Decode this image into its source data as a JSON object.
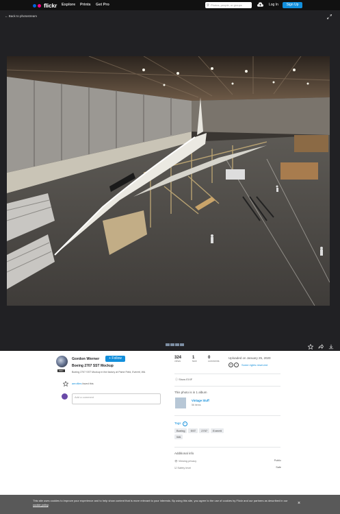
{
  "header": {
    "logo": "flickr",
    "nav": [
      "Explore",
      "Prints",
      "Get Pro"
    ],
    "search_placeholder": "Photos, people, or groups",
    "login": "Log In",
    "signup": "Sign Up",
    "colors": {
      "bar": "#111111",
      "signup": "#128fdc",
      "dot_blue": "#0063dc",
      "dot_pink": "#ff0084"
    }
  },
  "viewer": {
    "back_label": "Back to photostream",
    "icons": [
      "expand-icon",
      "star-icon",
      "share-icon",
      "download-icon"
    ]
  },
  "photo": {
    "owner": "Gordon Werner",
    "pro_badge": "PRO",
    "follow_label": "+ Follow",
    "title": "Boeing 2707 SST Mockup",
    "description": "Boeing 2707 SST Mockup in the factory at Paine Field, Everett, WA",
    "faves_user": "aerofiles",
    "faves_suffix": "faved this",
    "comment_placeholder": "Add a comment"
  },
  "stats": [
    {
      "value": "324",
      "label": "views"
    },
    {
      "value": "1",
      "label": "fave"
    },
    {
      "value": "0",
      "label": "comments"
    }
  ],
  "meta": {
    "uploaded": "Uploaded on January 25, 2020",
    "license": "Some rights reserved",
    "show_exif": "Show EXIF"
  },
  "album": {
    "section": "This photo is in 1 album",
    "name": "Vintage Stuff",
    "count": "56 items"
  },
  "tags": {
    "section": "Tags",
    "items": [
      "Boeing",
      "SST",
      "2707",
      "Everett",
      "WA"
    ]
  },
  "additional": {
    "section": "Additional info",
    "rows": [
      {
        "label": "Viewing privacy",
        "value": "Public"
      },
      {
        "label": "Safety level",
        "value": "Safe"
      }
    ]
  },
  "cookie": {
    "text": "This site uses cookies to improve your experience and to help show content that is more relevant to your interests. By using this site, you agree to the use of cookies by Flickr and our partners as described in our",
    "link": "cookie policy",
    "end": "."
  }
}
